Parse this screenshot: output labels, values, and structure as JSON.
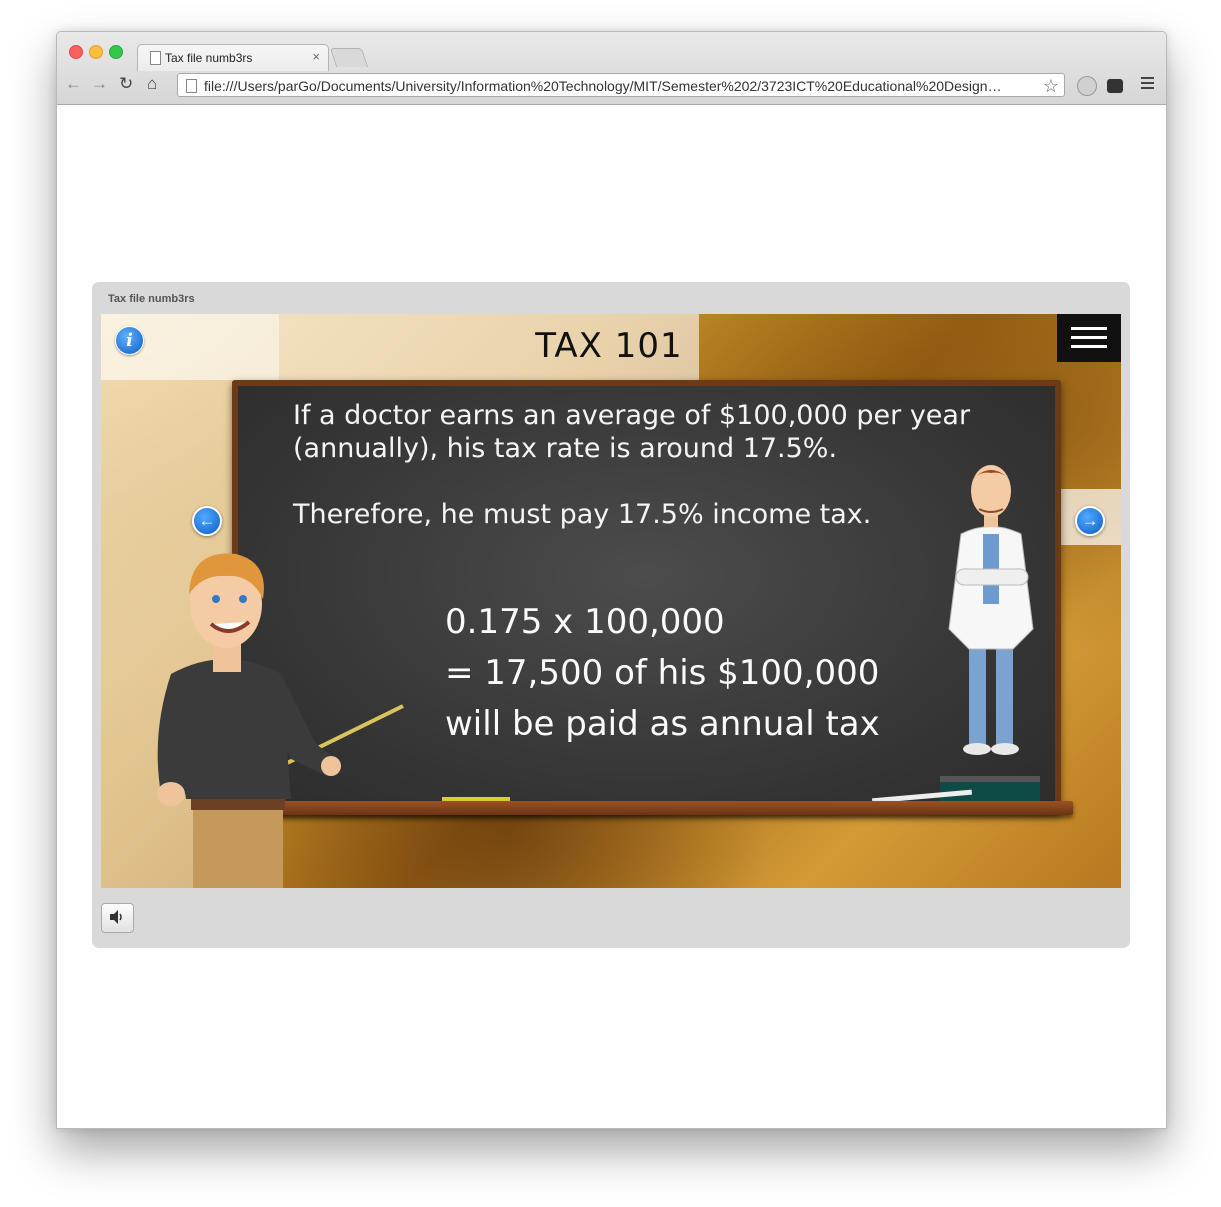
{
  "browser": {
    "tab_title": "Tax file numb3rs",
    "tab_close": "×",
    "address": "file:///Users/parGo/Documents/University/Information%20Technology/MIT/Semester%202/3723ICT%20Educational%20Design…",
    "nav": {
      "back": "←",
      "forward": "→",
      "reload": "↻",
      "home": "⌂",
      "star": "☆"
    }
  },
  "player": {
    "title": "Tax file numb3rs",
    "stage": {
      "heading": "TAX 101",
      "info_label": "i",
      "prev_label": "←",
      "next_label": "→",
      "paragraph_lines": [
        "If a doctor earns an average of $100,000 per year",
        "(annually), his tax rate is around 17.5%.",
        "Therefore, he must pay 17.5% income tax."
      ],
      "calc_lines": [
        "0.175 x 100,000",
        "= 17,500 of his $100,000",
        "will be paid as annual tax"
      ]
    }
  },
  "colors": {
    "info_blue": "#0c5ec6",
    "chalkboard": "#343434",
    "frame": "#6b3a16"
  },
  "icons": {
    "info": "info-icon",
    "prev": "arrow-left-icon",
    "next": "arrow-right-icon",
    "menu": "hamburger-menu-icon",
    "audio": "speaker-icon"
  }
}
